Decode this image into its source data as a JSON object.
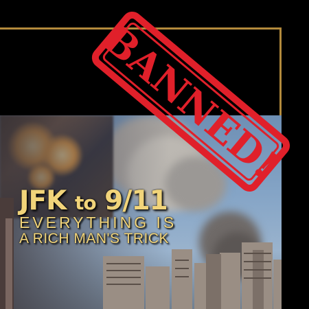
{
  "stamp": {
    "text": "BANNED!",
    "color": "#e0202a"
  },
  "title": {
    "part1": "JFK",
    "connector": "to",
    "part2": "9/11",
    "line2": "EVERYTHING IS",
    "line3": "A RICH MAN'S TRICK",
    "color": "#f1d47a"
  },
  "frame_color": "#b38a3c"
}
